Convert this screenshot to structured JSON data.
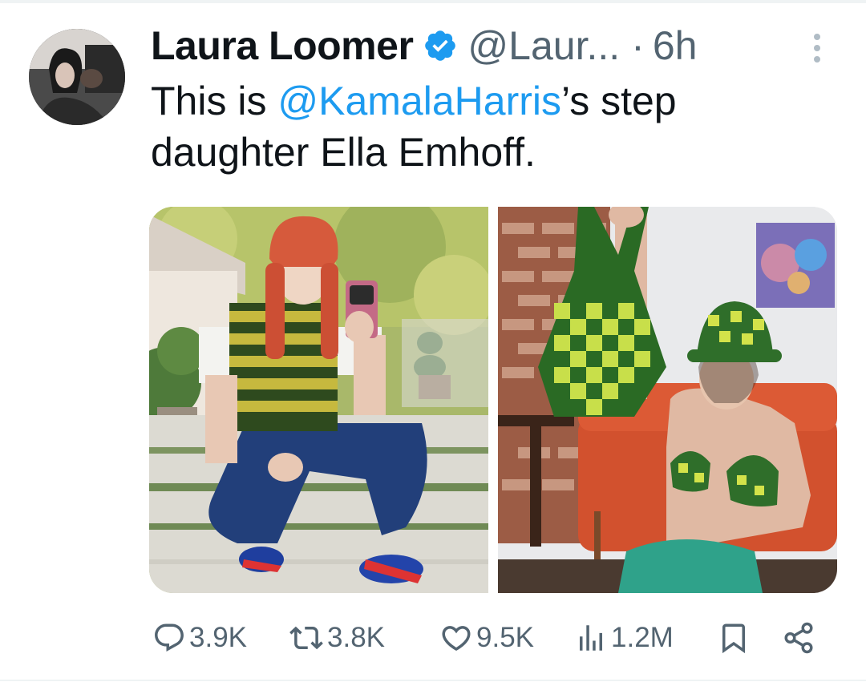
{
  "tweet": {
    "author_name": "Laura Loomer",
    "handle": "@Laur...",
    "separator": "·",
    "time": "6h",
    "text_before": "This is ",
    "mention": "@KamalaHarris",
    "text_after": "’s step daughter Ella Emhoff."
  },
  "actions": {
    "replies": "3.9K",
    "retweets": "3.8K",
    "likes": "9.5K",
    "views": "1.2M"
  },
  "icons": {
    "verified": "verified-badge-icon",
    "more": "more-vertical-icon",
    "reply": "reply-icon",
    "retweet": "retweet-icon",
    "like": "heart-icon",
    "views": "views-chart-icon",
    "bookmark": "bookmark-icon",
    "share": "share-icon"
  },
  "colors": {
    "accent": "#1d9bf0",
    "secondary_text": "#536471",
    "primary_text": "#0f1419"
  }
}
